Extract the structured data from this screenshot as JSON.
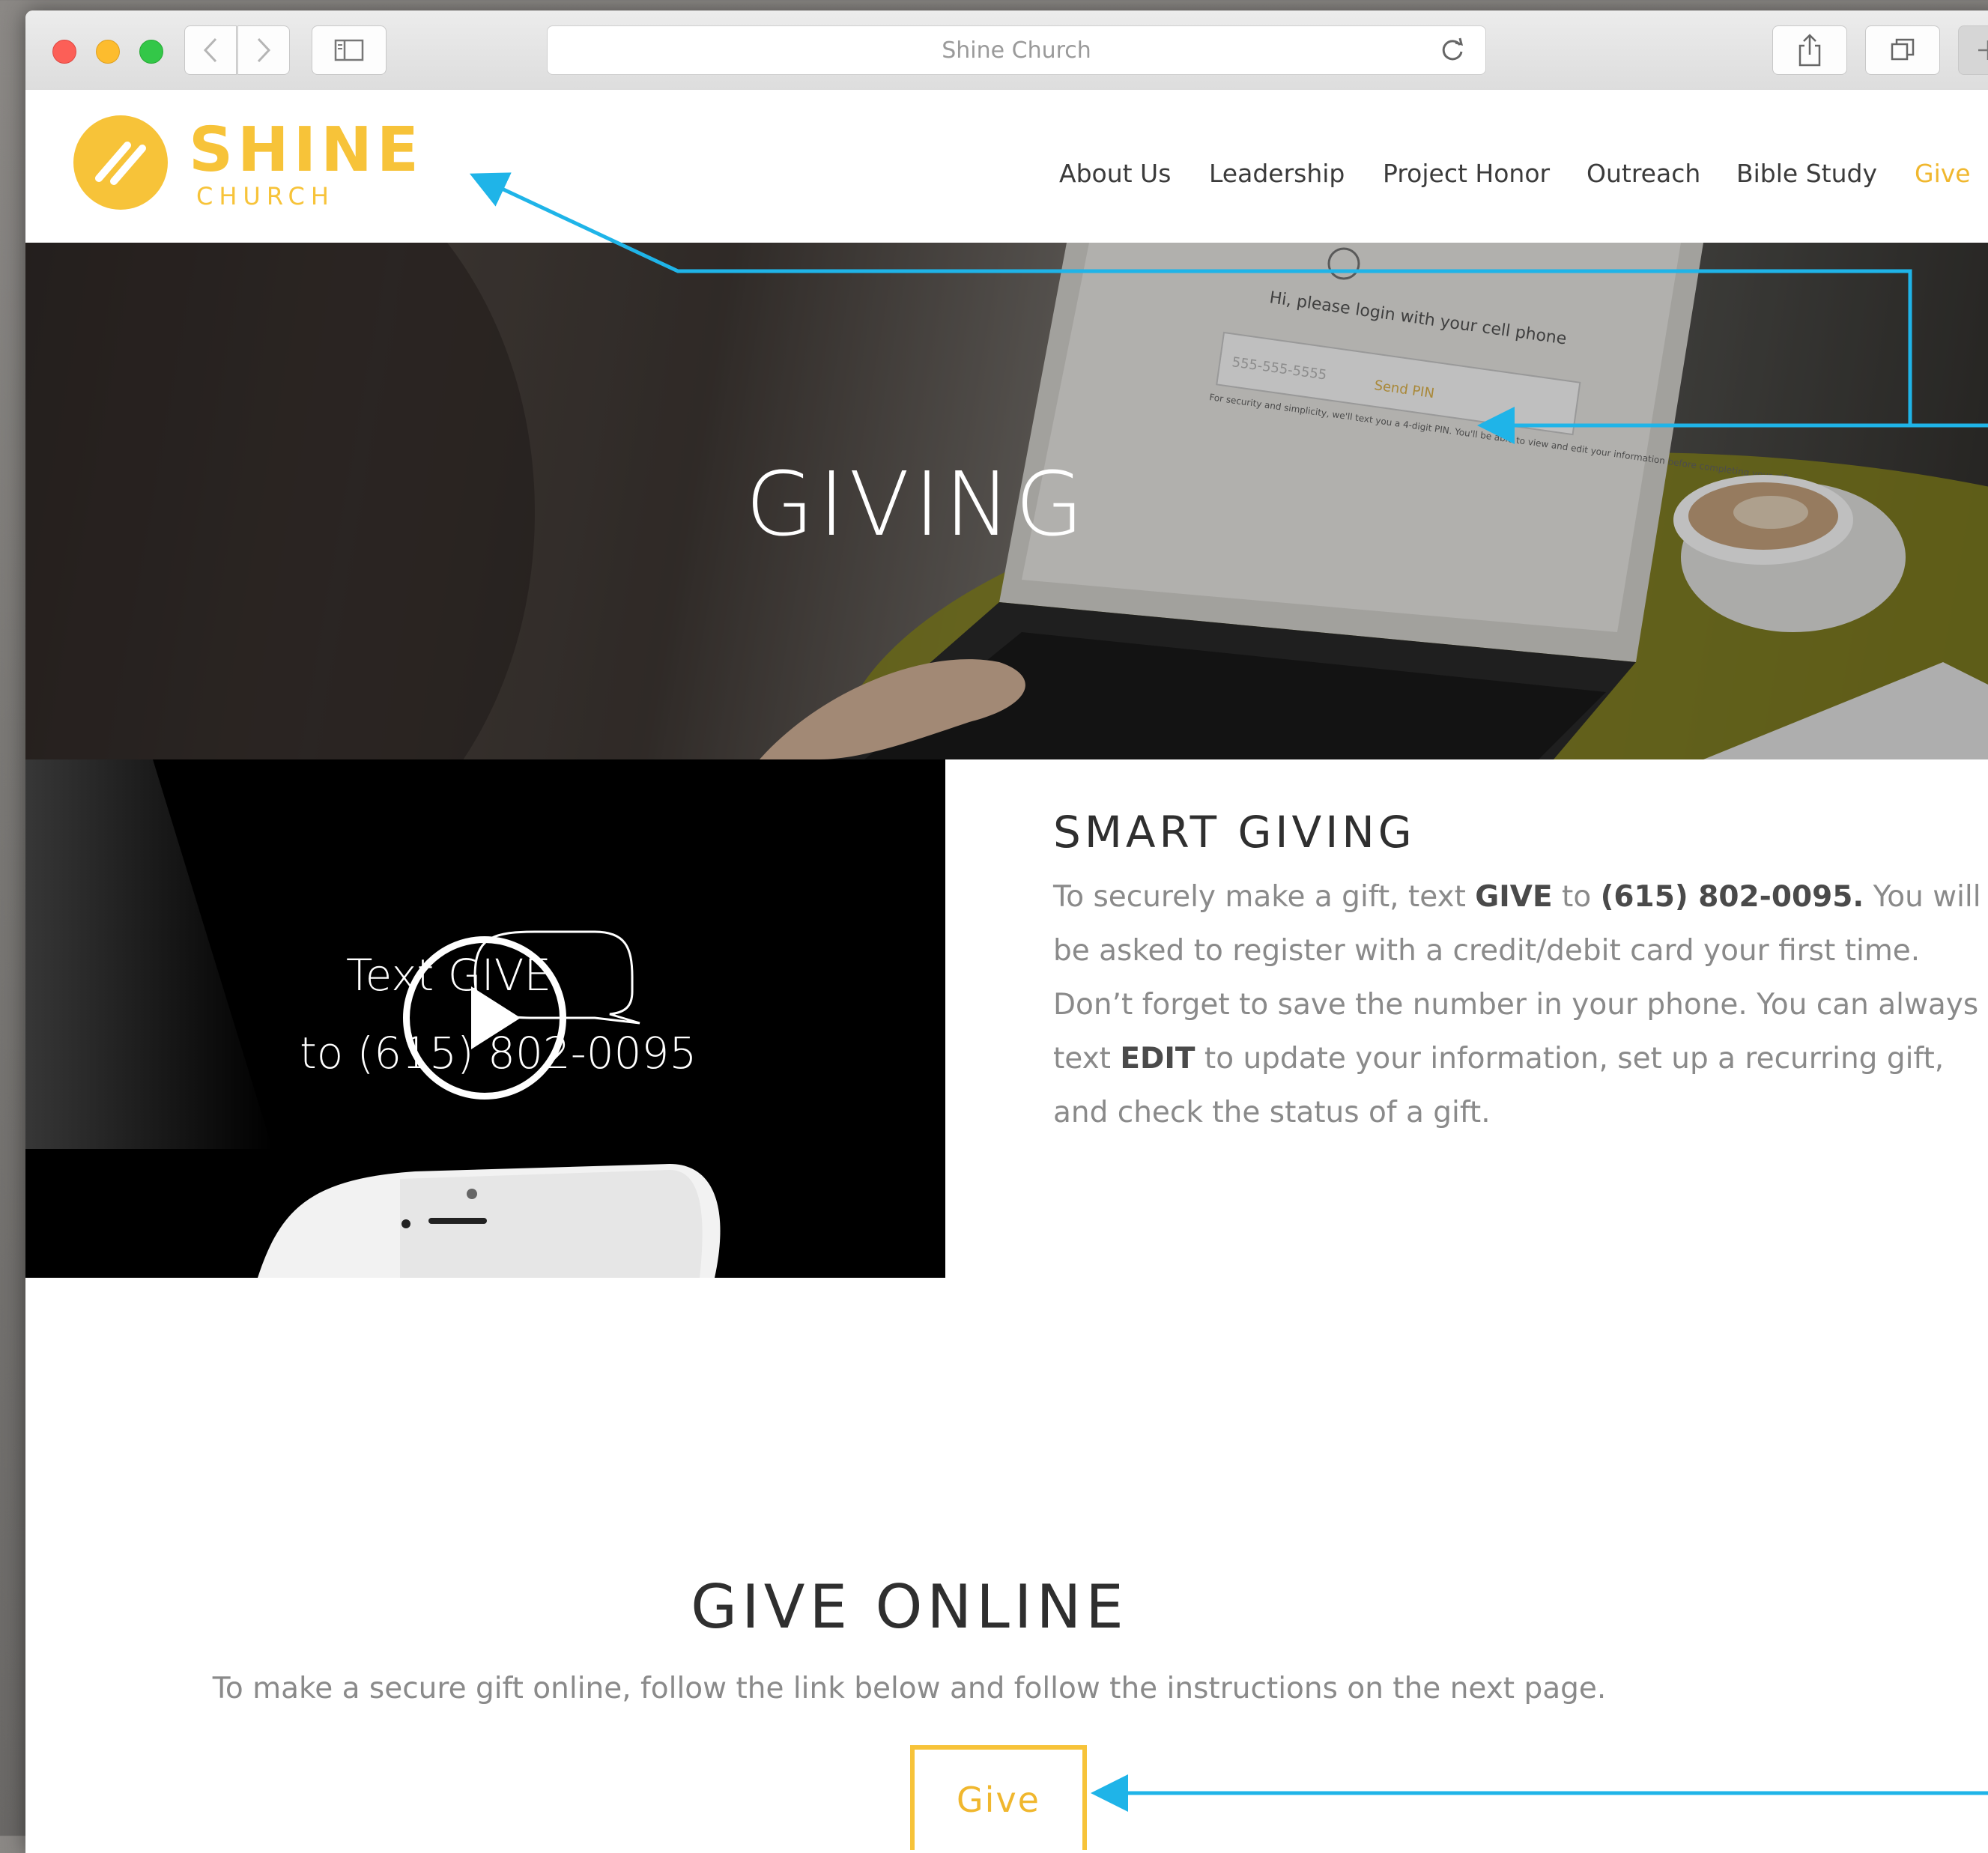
{
  "browser": {
    "address_text": "Shine Church"
  },
  "logo": {
    "word": "SHINE",
    "sub": "CHURCH"
  },
  "nav": {
    "items": [
      "About Us",
      "Leadership",
      "Project Honor",
      "Outreach",
      "Bible Study",
      "Give"
    ],
    "active": "Give"
  },
  "hero": {
    "title": "GIVING",
    "laptop_screen_text": "Hi, please login with your cell phone",
    "laptop_field_placeholder": "555-555-5555",
    "laptop_send_button": "Send PIN",
    "laptop_note": "For security and simplicity, we'll text you a 4-digit PIN. You'll be able to view and edit your information before completing your gift."
  },
  "video": {
    "line1": "Text GIVE",
    "line2": "to (615) 802-0095"
  },
  "smart_giving": {
    "title": "SMART GIVING",
    "p1": "To securely make a gift, text ",
    "keyword": "GIVE",
    "p2": " to ",
    "phone": "(615) 802-0095.",
    "p3": " You will be asked to register with a credit/debit card your first time. Don’t forget to save the number in your phone. You can always text ",
    "edit_keyword": "EDIT",
    "p4": " to update your information, set up a recurring gift, and check the status of a gift."
  },
  "give_online": {
    "title": "GIVE ONLINE",
    "body": "To make a secure gift online, follow the link below and follow the instructions on the next page.",
    "button": "Give"
  },
  "colors": {
    "accent": "#f7c339",
    "annotation": "#1fb4e8"
  }
}
